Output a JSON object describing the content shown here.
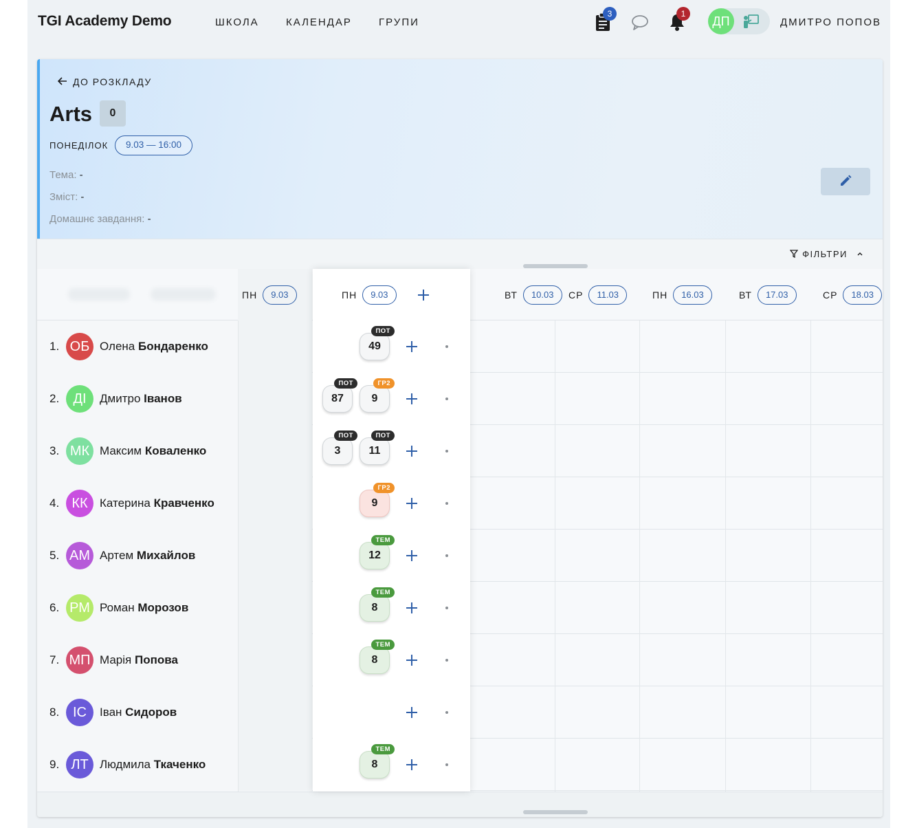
{
  "app": {
    "brand": "TGI Academy Demo",
    "nav": [
      "ШКОЛА",
      "КАЛЕНДАР",
      "ГРУПИ"
    ],
    "tasks_badge": "3",
    "notifications_badge": "1",
    "user_initials": "ДП",
    "user_name": "ДМИТРО ПОПОВ",
    "colors": {
      "accent": "#2f5fa8",
      "lesson_border": "#4aa8f0",
      "badge_blue": "#2d5fbf",
      "badge_red": "#b3262e"
    }
  },
  "lesson": {
    "back_label": "ДО РОЗКЛАДУ",
    "title": "Arts",
    "count": "0",
    "day": "ПОНЕДІЛОК",
    "datetime": "9.03 — 16:00",
    "topic_label": "Тема:",
    "topic_value": "-",
    "content_label": "Зміст:",
    "content_value": "-",
    "homework_label": "Домашнє завдання:",
    "homework_value": "-"
  },
  "filters_label": "ФІЛЬТРИ",
  "columns": [
    {
      "day": "ПН",
      "date": "9.03"
    },
    {
      "day": "ПН",
      "date": "9.03"
    },
    {
      "day": "ВТ",
      "date": "10.03"
    },
    {
      "day": "СР",
      "date": "11.03"
    },
    {
      "day": "ПН",
      "date": "16.03"
    },
    {
      "day": "ВТ",
      "date": "17.03"
    },
    {
      "day": "СР",
      "date": "18.03"
    }
  ],
  "students": [
    {
      "n": "1.",
      "initials": "ОБ",
      "first": "Олена",
      "last": "Бондаренко",
      "color": "#d84a4a",
      "grades": [
        {
          "value": "49",
          "tag": "ПОТ",
          "kind": "pot",
          "style": "gray"
        }
      ]
    },
    {
      "n": "2.",
      "initials": "ДІ",
      "first": "Дмитро",
      "last": "Іванов",
      "color": "#6ee07a",
      "grades": [
        {
          "value": "87",
          "tag": "ПОТ",
          "kind": "pot",
          "style": "gray"
        },
        {
          "value": "9",
          "tag": "ГР2",
          "kind": "gr",
          "style": "gray"
        }
      ]
    },
    {
      "n": "3.",
      "initials": "МК",
      "first": "Максим",
      "last": "Коваленко",
      "color": "#7ee0a0",
      "grades": [
        {
          "value": "3",
          "tag": "ПОТ",
          "kind": "pot",
          "style": "gray"
        },
        {
          "value": "11",
          "tag": "ПОТ",
          "kind": "pot",
          "style": "gray"
        }
      ]
    },
    {
      "n": "4.",
      "initials": "КК",
      "first": "Катерина",
      "last": "Кравченко",
      "color": "#c94fe0",
      "grades": [
        {
          "value": "9",
          "tag": "ГР2",
          "kind": "gr",
          "style": "pink"
        }
      ]
    },
    {
      "n": "5.",
      "initials": "АМ",
      "first": "Артем",
      "last": "Михайлов",
      "color": "#b65ad9",
      "grades": [
        {
          "value": "12",
          "tag": "ТЕМ",
          "kind": "tem",
          "style": "green"
        }
      ]
    },
    {
      "n": "6.",
      "initials": "РМ",
      "first": "Роман",
      "last": "Морозов",
      "color": "#b5ea6a",
      "grades": [
        {
          "value": "8",
          "tag": "ТЕМ",
          "kind": "tem",
          "style": "green"
        }
      ]
    },
    {
      "n": "7.",
      "initials": "МП",
      "first": "Марія",
      "last": "Попова",
      "color": "#d4506e",
      "grades": [
        {
          "value": "8",
          "tag": "ТЕМ",
          "kind": "tem",
          "style": "green"
        }
      ]
    },
    {
      "n": "8.",
      "initials": "ІС",
      "first": "Іван",
      "last": "Сидоров",
      "color": "#6a5ad9",
      "grades": []
    },
    {
      "n": "9.",
      "initials": "ЛТ",
      "first": "Людмила",
      "last": "Ткаченко",
      "color": "#6a5ad9",
      "grades": [
        {
          "value": "8",
          "tag": "ТЕМ",
          "kind": "tem",
          "style": "green"
        }
      ]
    }
  ]
}
